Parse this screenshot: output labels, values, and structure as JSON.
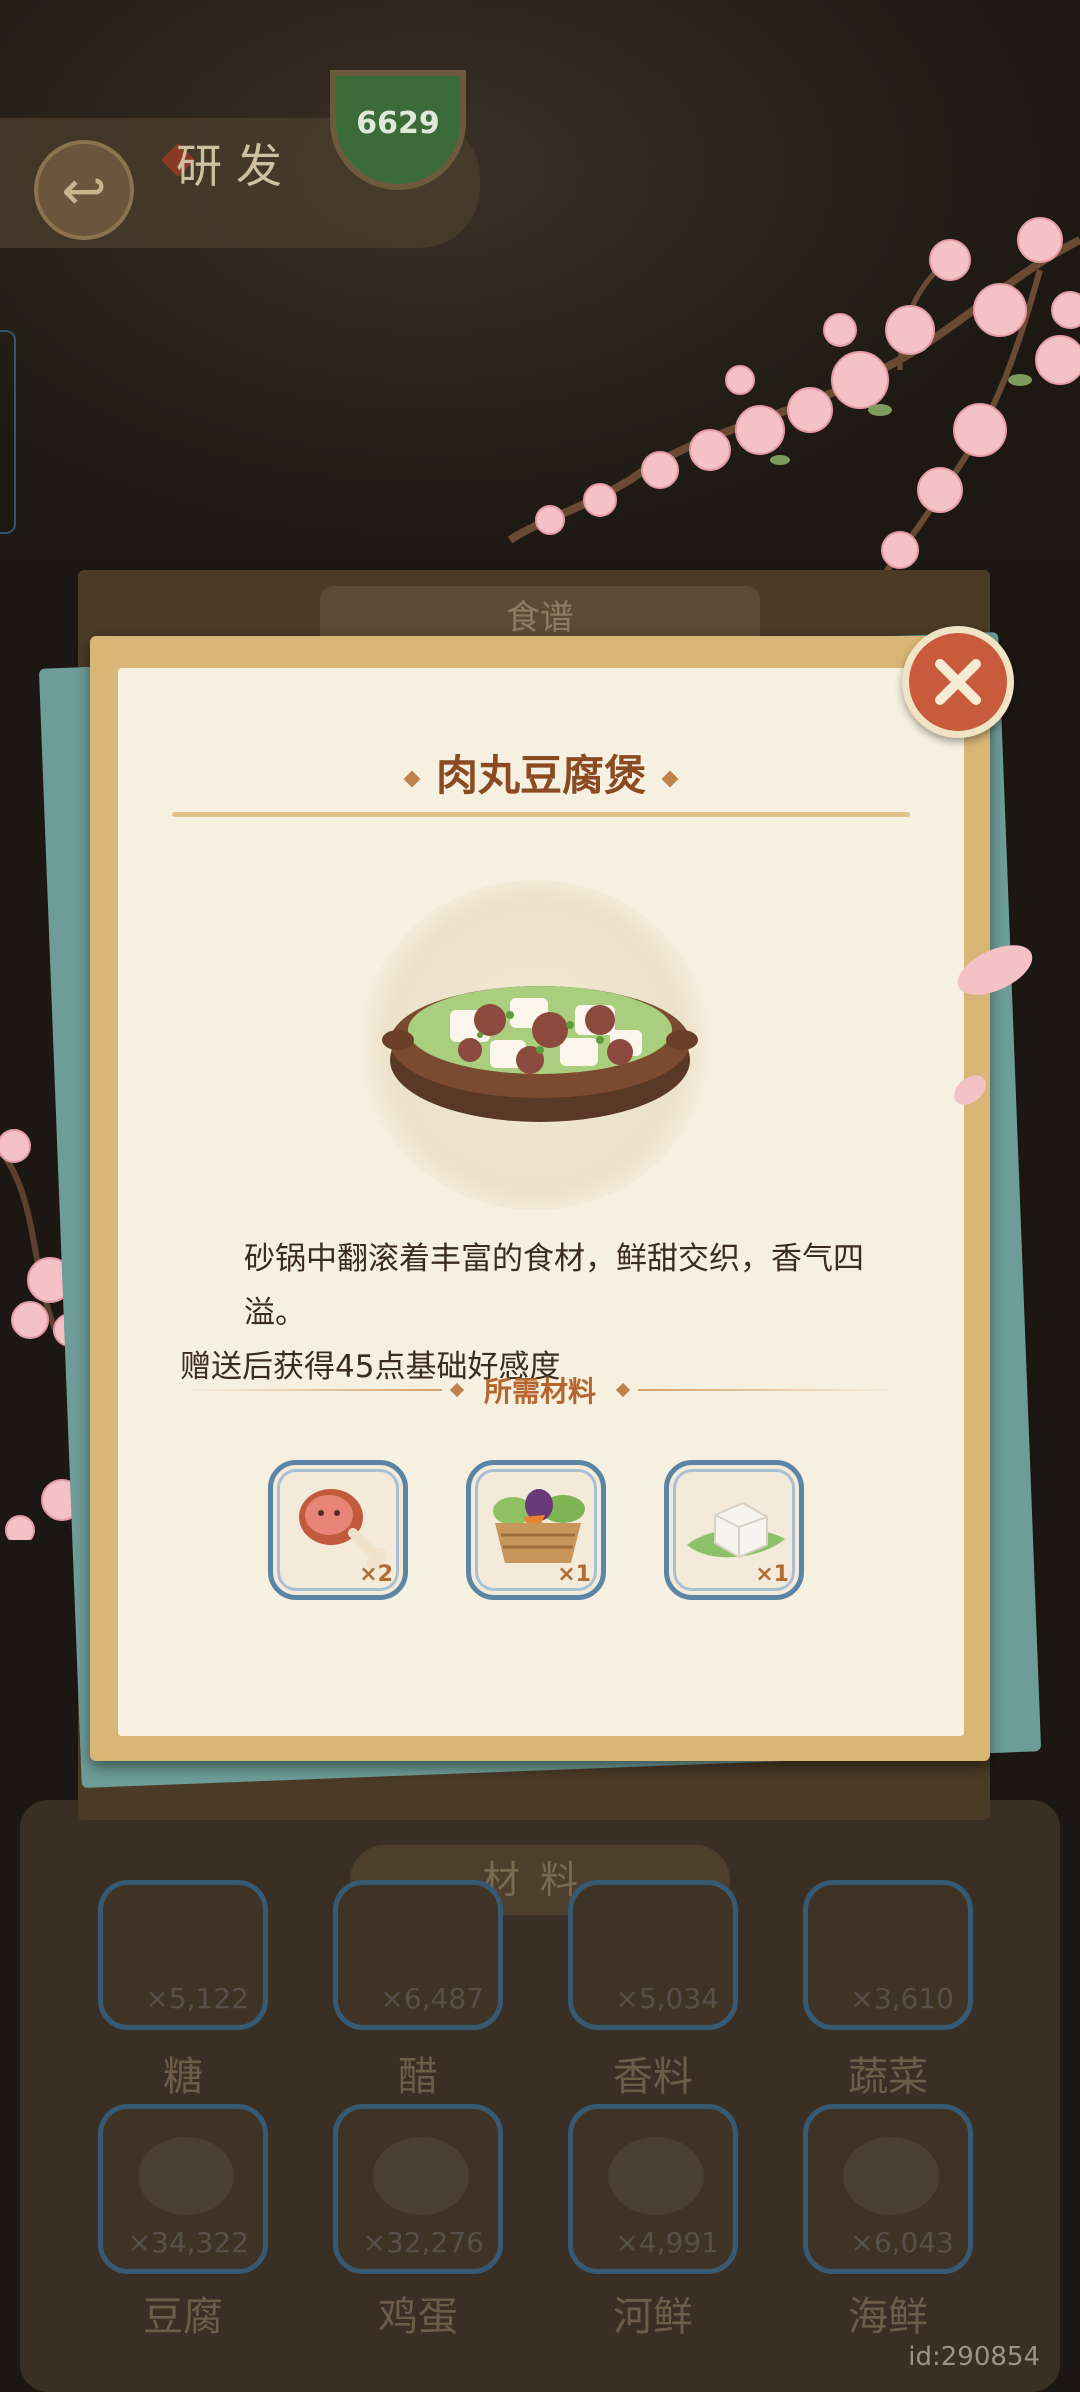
{
  "header": {
    "title": "研发",
    "currency": "6629"
  },
  "board": {
    "tab_label": "食谱"
  },
  "recipe": {
    "name": "肉丸豆腐煲",
    "description_line1": "砂锅中翻滚着丰富的食材，鲜甜交织，香气四溢。",
    "description_line2": "赠送后获得45点基础好感度",
    "requirements_label": "所需材料",
    "ingredients": [
      {
        "icon": "meat-drumstick-icon",
        "qty": "×2"
      },
      {
        "icon": "vegetable-basket-icon",
        "qty": "×1"
      },
      {
        "icon": "tofu-leaf-icon",
        "qty": "×1"
      }
    ]
  },
  "materials": {
    "header": "材料",
    "row1": [
      {
        "name": "糖",
        "count": "×5,122"
      },
      {
        "name": "醋",
        "count": "×6,487"
      },
      {
        "name": "香料",
        "count": "×5,034"
      },
      {
        "name": "蔬菜",
        "count": "×3,610"
      }
    ],
    "row2": [
      {
        "name": "豆腐",
        "count": "×34,322"
      },
      {
        "name": "鸡蛋",
        "count": "×32,276"
      },
      {
        "name": "河鲜",
        "count": "×4,991"
      },
      {
        "name": "海鲜",
        "count": "×6,043"
      }
    ]
  },
  "footer": {
    "id_label": "id:290854"
  },
  "colors": {
    "card_bg": "#f6f0e1",
    "title": "#8a4a22",
    "close_button": "#c95b3d",
    "ingredient_border": "#5c84a4"
  }
}
